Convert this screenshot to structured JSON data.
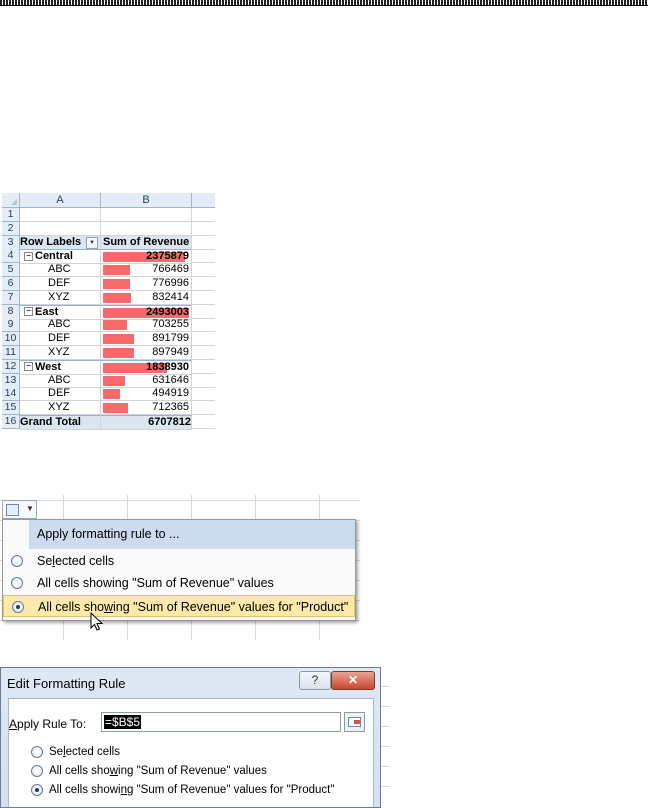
{
  "sheet": {
    "columns": [
      "A",
      "B"
    ],
    "header": {
      "row": "3",
      "col_a": "Row Labels",
      "col_b": "Sum of Revenue"
    },
    "rows": [
      {
        "num": "1",
        "a": "",
        "b": ""
      },
      {
        "num": "2",
        "a": "",
        "b": ""
      },
      {
        "num": "4",
        "a": "Central",
        "b": "2375879",
        "type": "group",
        "fill": 0.95
      },
      {
        "num": "5",
        "a": "ABC",
        "b": "766469",
        "type": "item",
        "fill": 0.31
      },
      {
        "num": "6",
        "a": "DEF",
        "b": "776996",
        "type": "item",
        "fill": 0.31
      },
      {
        "num": "7",
        "a": "XYZ",
        "b": "832414",
        "type": "item",
        "fill": 0.33
      },
      {
        "num": "8",
        "a": "East",
        "b": "2493003",
        "type": "group",
        "fill": 1.0
      },
      {
        "num": "9",
        "a": "ABC",
        "b": "703255",
        "type": "item",
        "fill": 0.28
      },
      {
        "num": "10",
        "a": "DEF",
        "b": "891799",
        "type": "item",
        "fill": 0.36
      },
      {
        "num": "11",
        "a": "XYZ",
        "b": "897949",
        "type": "item",
        "fill": 0.36
      },
      {
        "num": "12",
        "a": "West",
        "b": "1838930",
        "type": "group",
        "fill": 0.74
      },
      {
        "num": "13",
        "a": "ABC",
        "b": "631646",
        "type": "item",
        "fill": 0.25
      },
      {
        "num": "14",
        "a": "DEF",
        "b": "494919",
        "type": "item",
        "fill": 0.2
      },
      {
        "num": "15",
        "a": "XYZ",
        "b": "712365",
        "type": "item",
        "fill": 0.29
      }
    ],
    "total": {
      "num": "16",
      "a": "Grand Total",
      "b": "6707812"
    }
  },
  "menu": {
    "title": "Apply formatting rule to ...",
    "options": [
      {
        "label": "Selected cells",
        "selected": false
      },
      {
        "label": "All cells showing \"Sum of Revenue\" values",
        "selected": false
      },
      {
        "label": "All cells showing \"Sum of Revenue\" values for \"Product\"",
        "selected": true
      }
    ]
  },
  "dialog": {
    "title": "Edit Formatting Rule",
    "help_label": "?",
    "close_label": "✕",
    "apply_label": "Apply Rule To:",
    "apply_value": "=$B$5",
    "options": [
      {
        "label": "Selected cells",
        "selected": false
      },
      {
        "label": "All cells showing \"Sum of Revenue\" values",
        "selected": false
      },
      {
        "label": "All cells showing \"Sum of Revenue\" values for \"Product\"",
        "selected": true
      }
    ]
  },
  "colors": {
    "databar": "#f8696b",
    "header_fill": "#dce6f1",
    "menu_highlight": "#fde9a8"
  }
}
